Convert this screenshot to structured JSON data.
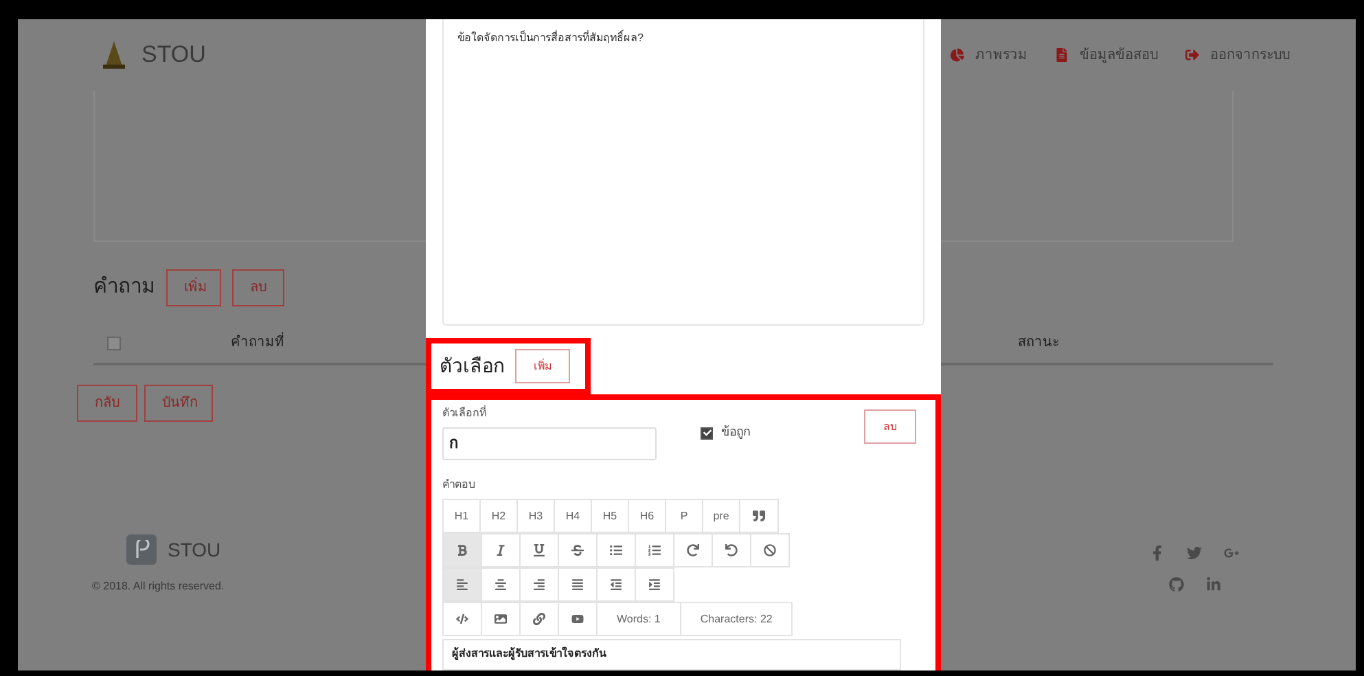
{
  "header": {
    "brand": "STOU",
    "nav": [
      {
        "label": "ภาพรวม",
        "kind": "chart"
      },
      {
        "label": "ข้อมูลข้อสอบ",
        "kind": "file"
      },
      {
        "label": "ออกจากระบบ",
        "kind": "logout"
      }
    ]
  },
  "questions": {
    "title": "คำถาม",
    "buttons": [
      "เพิ่ม",
      "ลบ"
    ],
    "select_all_checked": false,
    "columns": [
      "คำถามที่",
      "สถานะ"
    ]
  },
  "actions": [
    "กลับ",
    "บันทึก"
  ],
  "footer": {
    "brand": "STOU",
    "copyright": "© 2018. All rights reserved."
  },
  "modal": {
    "question_text": "ข้อใดจัดการเป็นการสื่อสารที่สัมฤทธิ์ผล?",
    "choices_title": "ตัวเลือก",
    "add_button": "เพิ่ม",
    "choice": {
      "label": "ตัวเลือกที่",
      "value": "ก",
      "correct_label": "ข้อถูก",
      "correct": true,
      "delete_button": "ลบ",
      "answer_label": "คำตอบ",
      "answer_text": "ผู้ส่งสารและผู้รับสารเข้าใจตรงกัน"
    },
    "toolbar": [
      [
        {
          "kind": "text",
          "label": "H1",
          "active": false
        },
        {
          "kind": "text",
          "label": "H2",
          "active": false
        },
        {
          "kind": "text",
          "label": "H3",
          "active": false
        },
        {
          "kind": "text",
          "label": "H4",
          "active": false
        },
        {
          "kind": "text",
          "label": "H5",
          "active": false
        },
        {
          "kind": "text",
          "label": "H6",
          "active": false
        },
        {
          "kind": "text",
          "label": "P",
          "active": false
        },
        {
          "kind": "text",
          "label": "pre",
          "active": false
        },
        {
          "kind": "quote",
          "active": false
        }
      ],
      [
        {
          "kind": "bold",
          "active": true
        },
        {
          "kind": "italic",
          "active": false
        },
        {
          "kind": "underline",
          "active": false
        },
        {
          "kind": "strike",
          "active": false
        },
        {
          "kind": "bullets",
          "active": false
        },
        {
          "kind": "numbers",
          "active": false
        },
        {
          "kind": "redo",
          "active": false
        },
        {
          "kind": "undo",
          "active": false
        },
        {
          "kind": "clear",
          "active": false
        }
      ],
      [
        {
          "kind": "align-left",
          "active": true
        },
        {
          "kind": "align-center",
          "active": false
        },
        {
          "kind": "align-right",
          "active": false
        },
        {
          "kind": "justify",
          "active": false
        },
        {
          "kind": "outdent",
          "active": false
        },
        {
          "kind": "indent",
          "active": false
        }
      ],
      [
        {
          "kind": "code",
          "active": false
        },
        {
          "kind": "image",
          "active": false
        },
        {
          "kind": "link",
          "active": false
        },
        {
          "kind": "video",
          "active": false
        },
        {
          "kind": "counter",
          "label": "Words: 1",
          "active": false
        },
        {
          "kind": "counter",
          "label": "Characters: 22",
          "active": false
        }
      ]
    ]
  }
}
